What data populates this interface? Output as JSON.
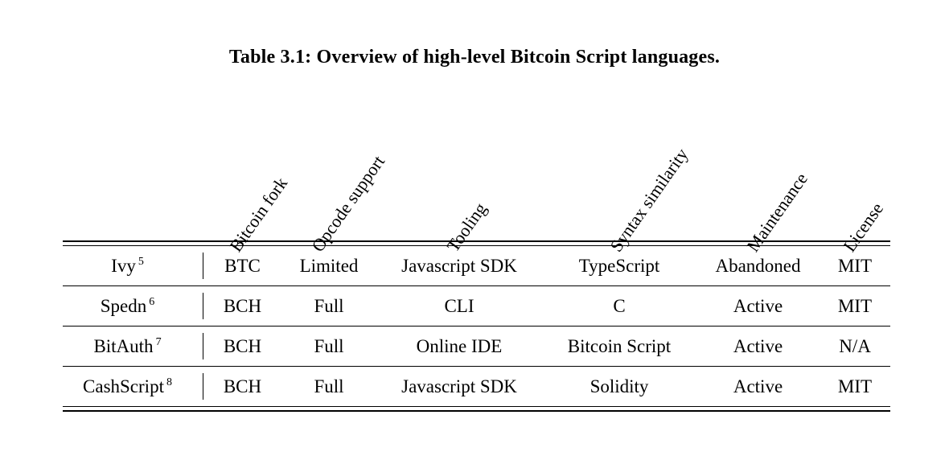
{
  "caption": {
    "label": "Table 3.1:",
    "text": "Table 3.1:  Overview of high-level Bitcoin Script languages."
  },
  "table": {
    "headers": [
      "",
      "Bitcoin fork",
      "Opcode support",
      "Tooling",
      "Syntax similarity",
      "Maintenance",
      "License"
    ],
    "rows": [
      {
        "name": "Ivy",
        "footnote": "5",
        "fork": "BTC",
        "opcode": "Limited",
        "tooling": "Javascript SDK",
        "syntax": "TypeScript",
        "maintenance": "Abandoned",
        "license": "MIT"
      },
      {
        "name": "Spedn",
        "footnote": "6",
        "fork": "BCH",
        "opcode": "Full",
        "tooling": "CLI",
        "syntax": "C",
        "maintenance": "Active",
        "license": "MIT"
      },
      {
        "name": "BitAuth",
        "footnote": "7",
        "fork": "BCH",
        "opcode": "Full",
        "tooling": "Online IDE",
        "syntax": "Bitcoin Script",
        "maintenance": "Active",
        "license": "N/A"
      },
      {
        "name": "CashScript",
        "footnote": "8",
        "fork": "BCH",
        "opcode": "Full",
        "tooling": "Javascript SDK",
        "syntax": "Solidity",
        "maintenance": "Active",
        "license": "MIT"
      }
    ]
  },
  "style": {
    "text_color": "#000000",
    "background_color": "#ffffff",
    "rule_color": "#000000",
    "header_rotation_deg": "-55"
  }
}
